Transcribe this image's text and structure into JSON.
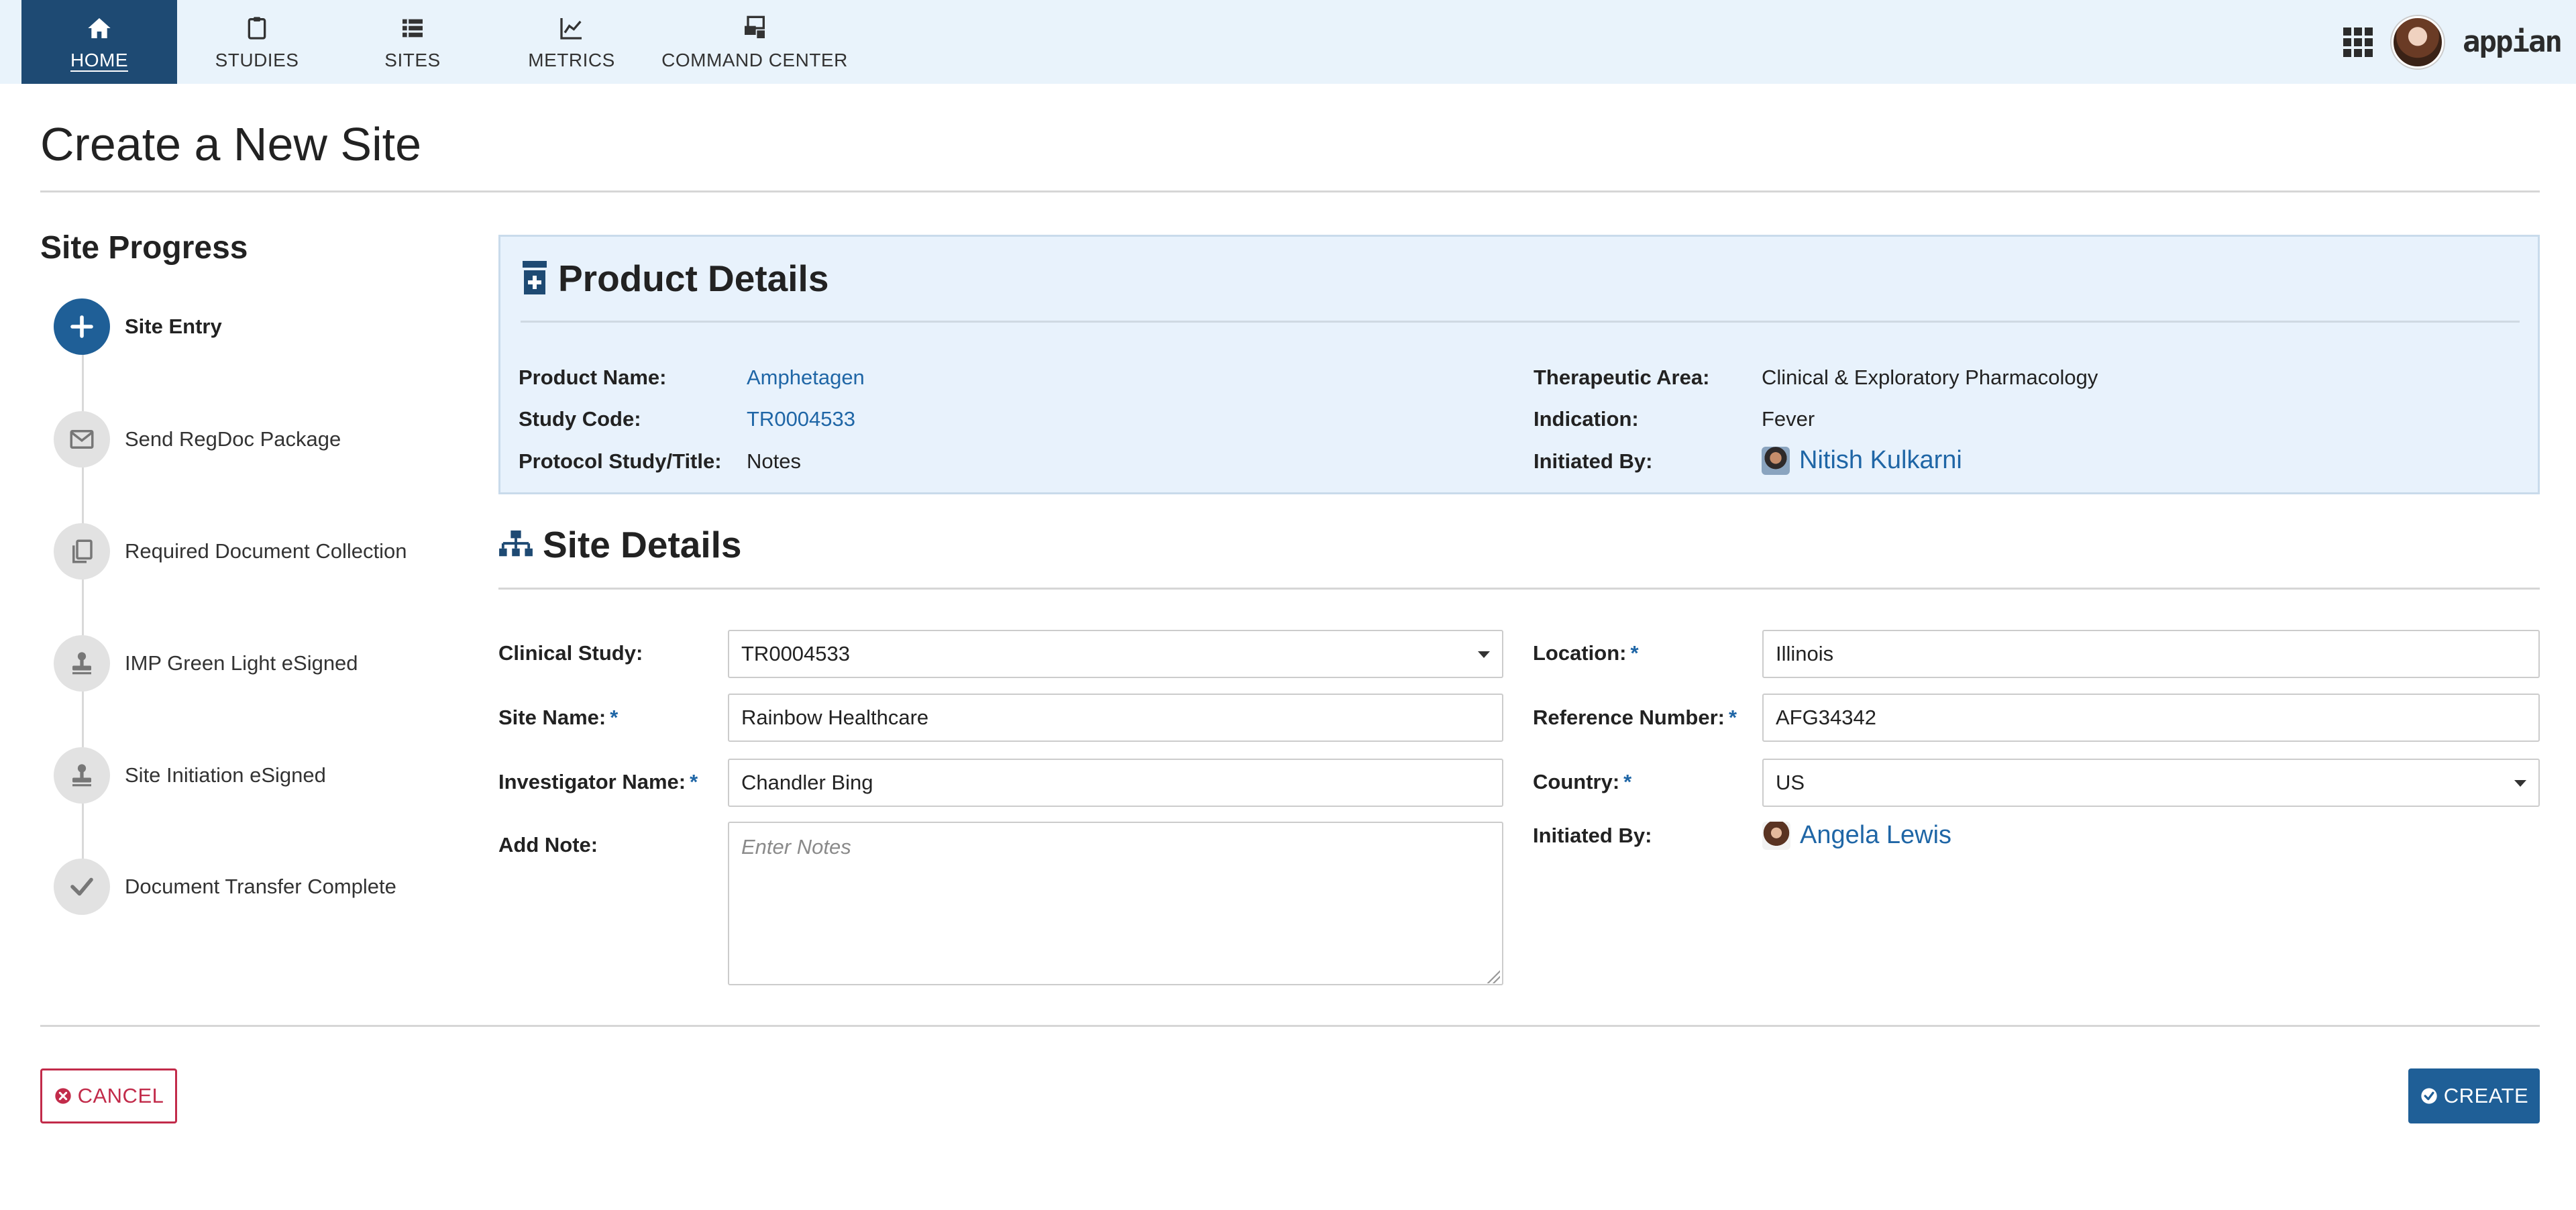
{
  "nav": {
    "items": [
      {
        "label": "HOME",
        "icon": "home-icon"
      },
      {
        "label": "STUDIES",
        "icon": "clipboard-icon"
      },
      {
        "label": "SITES",
        "icon": "list-icon"
      },
      {
        "label": "METRICS",
        "icon": "line-chart-icon"
      },
      {
        "label": "COMMAND CENTER",
        "icon": "command-center-icon"
      }
    ],
    "brand": "appian"
  },
  "page": {
    "title": "Create a New Site"
  },
  "sidebar": {
    "title": "Site Progress",
    "steps": [
      {
        "label": "Site Entry",
        "icon": "plus-icon",
        "active": true
      },
      {
        "label": "Send RegDoc Package",
        "icon": "envelope-icon",
        "active": false
      },
      {
        "label": "Required Document Collection",
        "icon": "documents-icon",
        "active": false
      },
      {
        "label": "IMP Green Light eSigned",
        "icon": "stamp-icon",
        "active": false
      },
      {
        "label": "Site Initiation eSigned",
        "icon": "stamp-icon",
        "active": false
      },
      {
        "label": "Document Transfer Complete",
        "icon": "checkmark-icon",
        "active": false
      }
    ]
  },
  "product_details": {
    "title": "Product Details",
    "product_name_label": "Product Name:",
    "product_name": "Amphetagen",
    "study_code_label": "Study Code:",
    "study_code": "TR0004533",
    "protocol_label": "Protocol Study/Title:",
    "protocol": "Notes",
    "therapeutic_area_label": "Therapeutic Area:",
    "therapeutic_area": "Clinical & Exploratory Pharmacology",
    "indication_label": "Indication:",
    "indication": "Fever",
    "initiated_by_label": "Initiated By:",
    "initiated_by": "Nitish Kulkarni"
  },
  "site_details": {
    "title": "Site Details",
    "required_marker": "*",
    "clinical_study_label": "Clinical Study:",
    "clinical_study_value": "TR0004533",
    "site_name_label": "Site Name:",
    "site_name_value": "Rainbow Healthcare",
    "investigator_label": "Investigator Name:",
    "investigator_value": "Chandler Bing",
    "add_note_label": "Add Note:",
    "add_note_placeholder": "Enter Notes",
    "location_label": "Location:",
    "location_value": "Illinois",
    "reference_label": "Reference Number:",
    "reference_value": "AFG34342",
    "country_label": "Country:",
    "country_value": "US",
    "initiated_by_label": "Initiated By:",
    "initiated_by": "Angela Lewis"
  },
  "footer": {
    "cancel_label": "CANCEL",
    "create_label": "CREATE"
  },
  "colors": {
    "nav_bg": "#e9f3fb",
    "nav_active": "#1e4a73",
    "accent": "#1f5f97",
    "link": "#1f66a6",
    "cancel": "#c22b4a",
    "card_bg": "#e8f2fc"
  }
}
